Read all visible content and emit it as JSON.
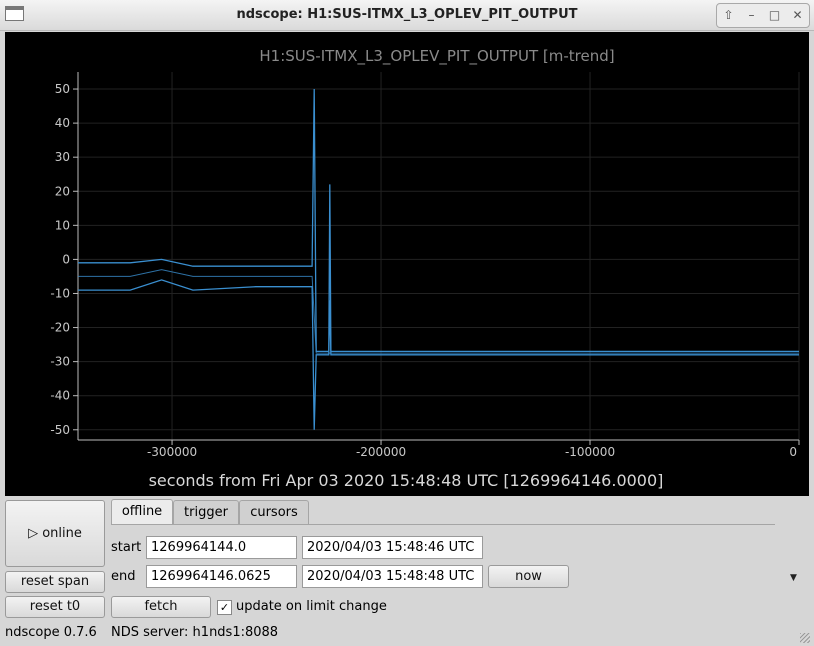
{
  "window": {
    "title": "ndscope: H1:SUS-ITMX_L3_OPLEV_PIT_OUTPUT"
  },
  "plot": {
    "title": "H1:SUS-ITMX_L3_OPLEV_PIT_OUTPUT [m-trend]",
    "xlabel": "seconds from Fri Apr 03 2020 15:48:48 UTC [1269964146.0000]",
    "line_color": "#3a8fd0"
  },
  "chart_data": {
    "type": "line",
    "title": "H1:SUS-ITMX_L3_OPLEV_PIT_OUTPUT [m-trend]",
    "xlabel": "seconds from Fri Apr 03 2020 15:48:48 UTC [1269964146.0000]",
    "ylabel": "",
    "xlim": [
      -345000,
      0
    ],
    "ylim": [
      -53,
      55
    ],
    "xticks": [
      -300000,
      -200000,
      -100000,
      0
    ],
    "xtick_labels": [
      "-300000",
      "-200000",
      "-100000",
      "0"
    ],
    "yticks": [
      50,
      40,
      30,
      20,
      10,
      0,
      -10,
      -20,
      -30,
      -40,
      -50
    ],
    "ytick_labels": [
      "50",
      "40",
      "30",
      "20",
      "10",
      "0",
      "-10",
      "-20",
      "-30",
      "-40",
      "-50"
    ],
    "grid": true,
    "series": [
      {
        "role": "max",
        "values": [
          [
            -345000,
            -1
          ],
          [
            -320000,
            -1
          ],
          [
            -305000,
            0
          ],
          [
            -290000,
            -2
          ],
          [
            -260000,
            -2
          ],
          [
            -233000,
            -2
          ],
          [
            -232000,
            50
          ],
          [
            -231000,
            -27
          ],
          [
            -225000,
            -27
          ],
          [
            -224500,
            22
          ],
          [
            -224000,
            -27
          ],
          [
            0,
            -27
          ]
        ]
      },
      {
        "role": "mean",
        "values": [
          [
            -345000,
            -5
          ],
          [
            -320000,
            -5
          ],
          [
            -305000,
            -3
          ],
          [
            -290000,
            -5
          ],
          [
            -260000,
            -5
          ],
          [
            -233000,
            -5
          ],
          [
            -231000,
            -27.5
          ],
          [
            0,
            -27.5
          ]
        ]
      },
      {
        "role": "min",
        "values": [
          [
            -345000,
            -9
          ],
          [
            -320000,
            -9
          ],
          [
            -305000,
            -6
          ],
          [
            -290000,
            -9
          ],
          [
            -260000,
            -8
          ],
          [
            -233000,
            -8
          ],
          [
            -232000,
            -50
          ],
          [
            -231000,
            -28
          ],
          [
            -225000,
            -28
          ],
          [
            -224500,
            -12
          ],
          [
            -224000,
            -28
          ],
          [
            0,
            -28
          ]
        ]
      }
    ]
  },
  "controls": {
    "online_label": "▷ online",
    "reset_span_label": "reset span",
    "reset_t0_label": "reset t0",
    "tabs": [
      "offline",
      "trigger",
      "cursors"
    ],
    "start_label": "start",
    "end_label": "end",
    "start_gps": "1269964144.0",
    "start_utc": "2020/04/03 15:48:46 UTC",
    "end_gps": "1269964146.0625",
    "end_utc": "2020/04/03 15:48:48 UTC",
    "now_label": "now",
    "fetch_label": "fetch",
    "update_label": "update on limit change",
    "update_checked": "✓"
  },
  "status": {
    "version": "ndscope 0.7.6",
    "server": "NDS server: h1nds1:8088"
  }
}
